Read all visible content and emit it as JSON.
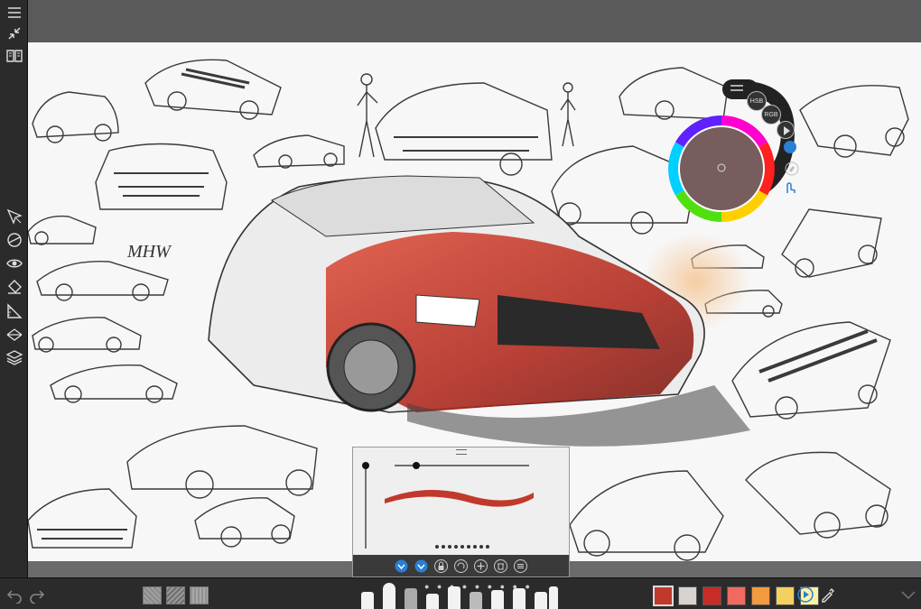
{
  "app": {
    "name": "sketch-app"
  },
  "left_toolbar": {
    "items": [
      {
        "icon": "menu-icon"
      },
      {
        "icon": "collapse-icon"
      },
      {
        "icon": "book-icon"
      },
      {
        "icon": "transform-icon"
      },
      {
        "icon": "symmetry-icon"
      },
      {
        "icon": "visibility-icon"
      },
      {
        "icon": "fill-icon"
      },
      {
        "icon": "ruler-icon"
      },
      {
        "icon": "perspective-icon"
      },
      {
        "icon": "layers-icon"
      }
    ]
  },
  "color_puck": {
    "modes": [
      "HSB",
      "RGB"
    ],
    "current_color": "#8b7575"
  },
  "brush_panel": {
    "size_slider_level": 0.08,
    "opacity_slider_level": 0.2,
    "stroke_color": "#c0392b",
    "page_dots": 9
  },
  "bottom_bar": {
    "textures": [
      "texture-1",
      "texture-2",
      "texture-3"
    ],
    "swatches": [
      "#c0392b",
      "#d8d3cf",
      "#c62c28",
      "#f06a60",
      "#f29a3f",
      "#f3d160",
      "#fbf2a3"
    ],
    "selected_swatch": 0
  },
  "colors": {
    "accent": "#2a7fd4",
    "toolbar_bg": "#2b2b2b",
    "topbar_bg": "#5a5a5a"
  }
}
